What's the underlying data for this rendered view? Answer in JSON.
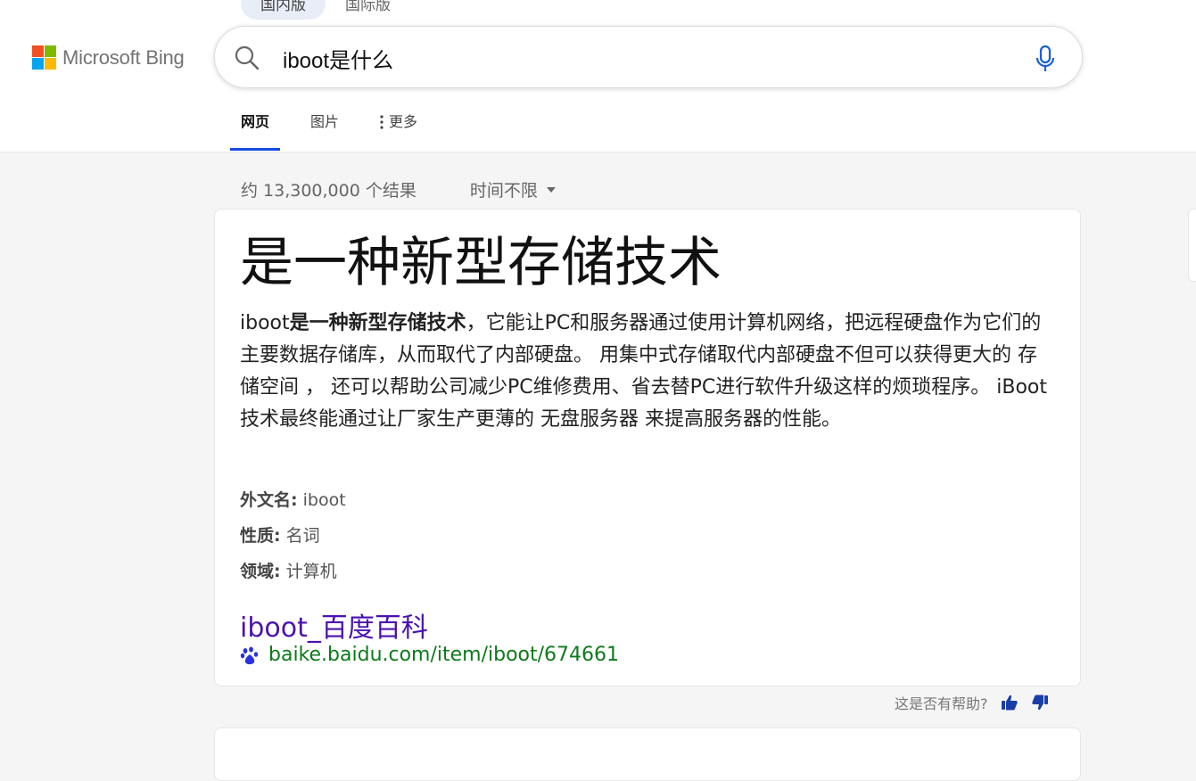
{
  "region_tabs": [
    "国内版",
    "国际版"
  ],
  "logo": {
    "text": "Microsoft Bing",
    "colors": [
      "#f25022",
      "#7fba00",
      "#00a4ef",
      "#ffb900"
    ]
  },
  "search": {
    "query": "iboot是什么"
  },
  "nav": {
    "items": [
      "网页",
      "图片",
      "更多"
    ],
    "active": "网页"
  },
  "results_meta": {
    "count": "约 13,300,000 个结果",
    "time_filter": "时间不限"
  },
  "answer_card": {
    "title": "是一种新型存储技术",
    "body_prefix": "iboot",
    "body_bold": "是一种新型存储技术",
    "body_rest": "，它能让PC和服务器通过使用计算机网络，把远程硬盘作为它们的主要数据存储库，从而取代了内部硬盘。 用集中式存储取代内部硬盘不但可以获得更大的 存储空间 ， 还可以帮助公司减少PC维修费用、省去替PC进行软件升级这样的烦琐程序。 iBoot技术最终能通过让厂家生产更薄的 无盘服务器 来提高服务器的性能。",
    "facts": [
      {
        "label": "外文名:",
        "value": "iboot"
      },
      {
        "label": "性质:",
        "value": "名词"
      },
      {
        "label": "领域:",
        "value": "计算机"
      }
    ],
    "source_title": "iboot_百度百科",
    "source_url": "baike.baidu.com/item/iboot/674661"
  },
  "feedback": {
    "question": "这是否有帮助?"
  },
  "colors": {
    "accent": "#174ae4",
    "link_visited": "#4a12b0",
    "url_green": "#0d7a1a",
    "thumb": "#1a3ea8"
  }
}
